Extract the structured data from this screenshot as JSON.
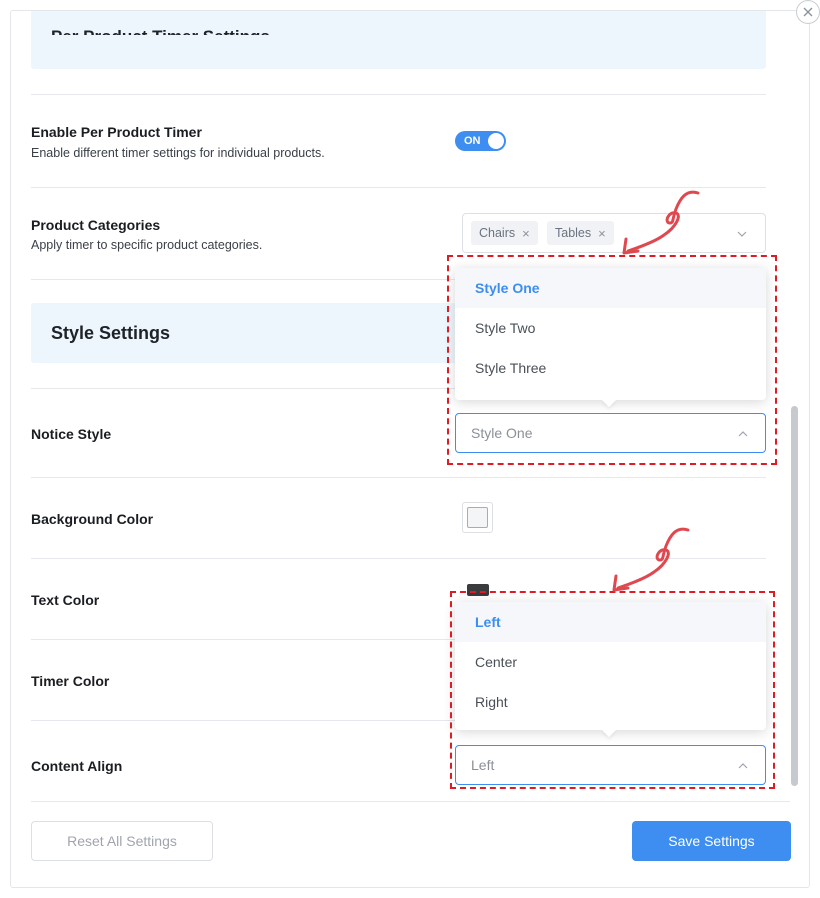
{
  "top_section": {
    "title": "Per Product Timer Settings"
  },
  "per_product_timer": {
    "title": "Enable Per Product Timer",
    "description": "Enable different timer settings for individual products.",
    "toggle_label": "ON",
    "enabled": true
  },
  "product_categories": {
    "title": "Product Categories",
    "description": "Apply timer to specific product categories.",
    "tags": [
      "Chairs",
      "Tables"
    ],
    "tag_remove_glyph": "×"
  },
  "style_settings": {
    "title": "Style Settings"
  },
  "notice_style": {
    "title": "Notice Style",
    "value": "Style One",
    "options": [
      "Style One",
      "Style Two",
      "Style Three"
    ],
    "selected": "Style One"
  },
  "background_color": {
    "title": "Background Color"
  },
  "text_color": {
    "title": "Text Color"
  },
  "timer_color": {
    "title": "Timer Color"
  },
  "content_align": {
    "title": "Content Align",
    "value": "Left",
    "options": [
      "Left",
      "Center",
      "Right"
    ],
    "selected": "Left"
  },
  "footer": {
    "reset_label": "Reset All Settings",
    "save_label": "Save Settings"
  },
  "colors": {
    "accent": "#3d8ef0",
    "annotation_red": "#e01b24",
    "banner_bg": "#edf6fc"
  },
  "icons": {
    "close": "close-icon",
    "chevron_down": "chevron-down-icon",
    "chevron_up": "chevron-up-icon",
    "annotation_arrow": "curved-arrow-annotation"
  }
}
